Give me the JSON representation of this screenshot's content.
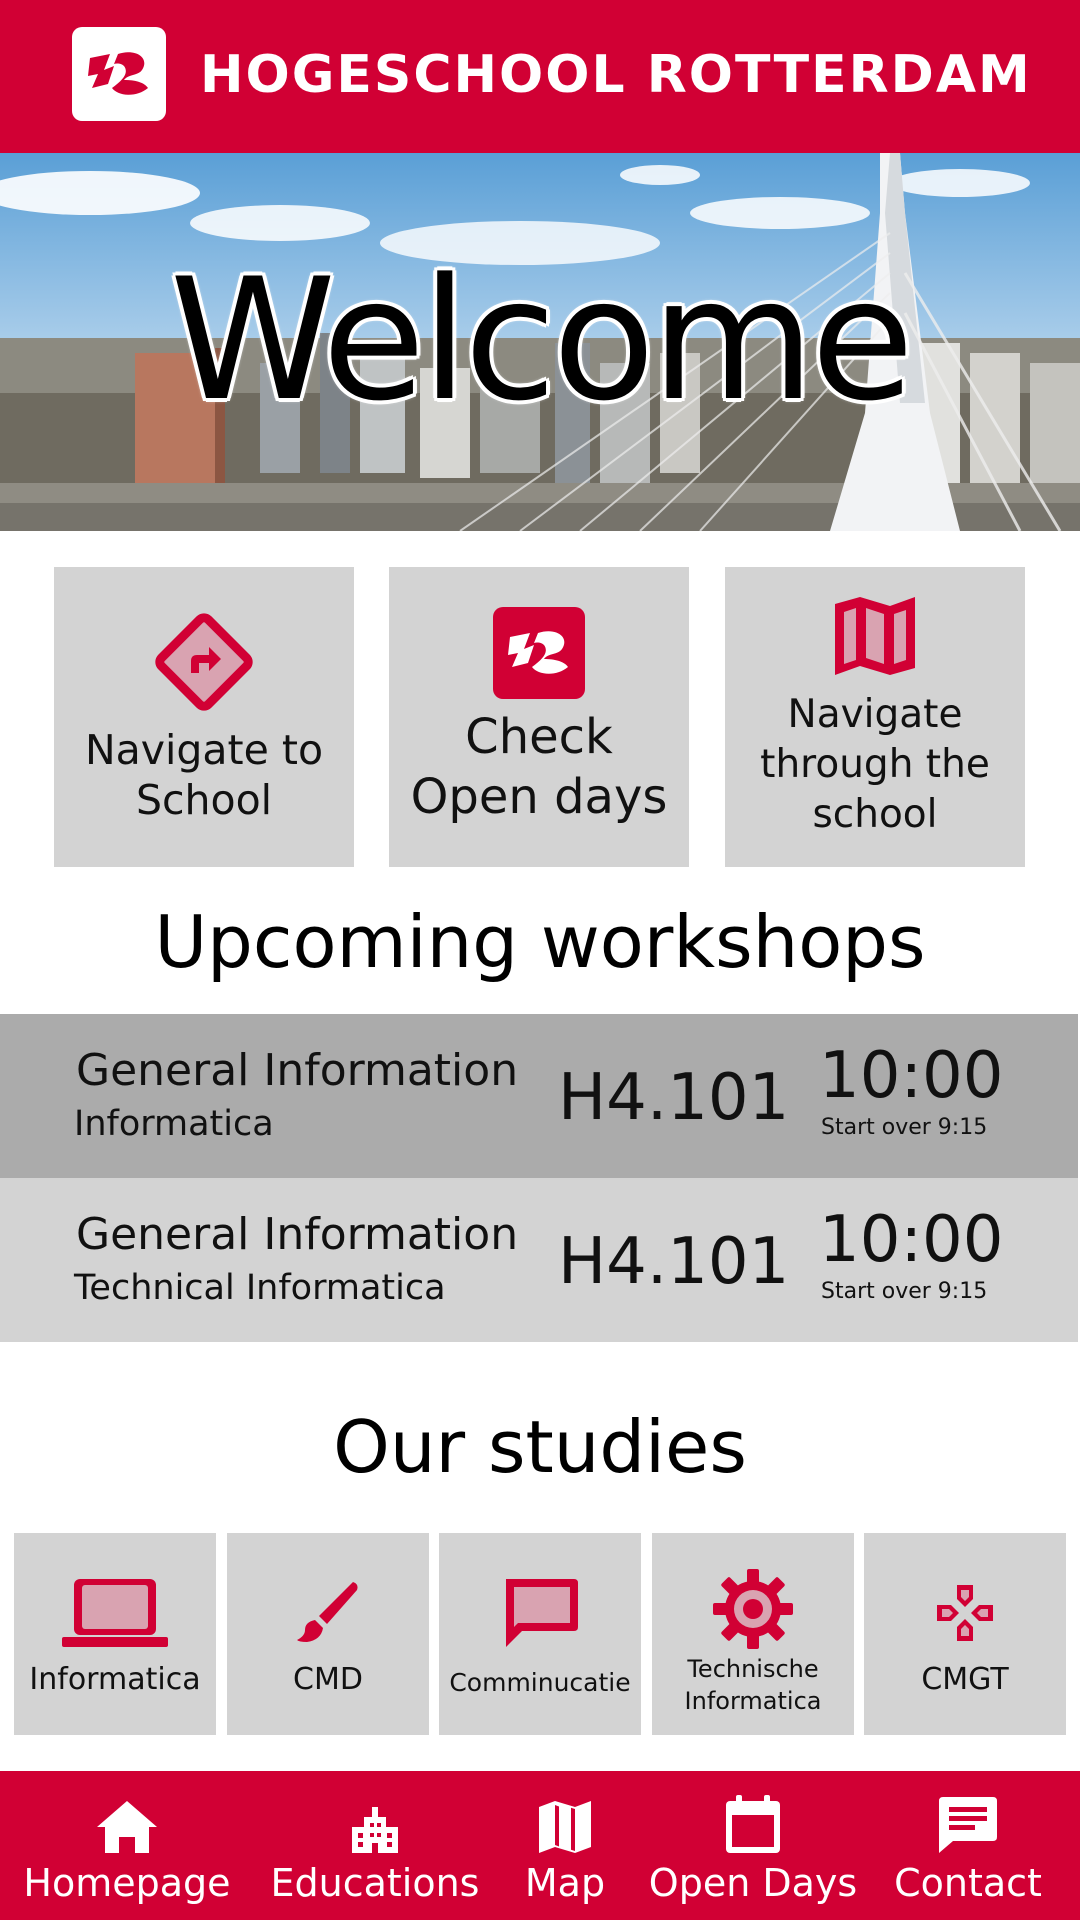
{
  "header": {
    "brand": "HOGESCHOOL ROTTERDAM",
    "logo_icon": "hr-logo-icon"
  },
  "hero": {
    "title": "Welcome"
  },
  "actions": [
    {
      "label_line1": "Navigate to",
      "label_line2": "School",
      "icon": "directions-icon"
    },
    {
      "label_line1": "Check",
      "label_line2": "Open days",
      "icon": "hr-logo-icon"
    },
    {
      "label_line1": "Navigate",
      "label_line2": "through the",
      "label_line3": "school",
      "icon": "map-icon"
    }
  ],
  "workshops": {
    "title": "Upcoming workshops",
    "items": [
      {
        "title": "General Information",
        "study": "Informatica",
        "room": "H4.101",
        "time": "10:00",
        "start": "Start over 9:15"
      },
      {
        "title": "General Information",
        "study": "Technical Informatica",
        "room": "H4.101",
        "time": "10:00",
        "start": "Start over 9:15"
      }
    ]
  },
  "studies": {
    "title": "Our studies",
    "items": [
      {
        "label": "Informatica",
        "icon": "laptop-icon"
      },
      {
        "label": "CMD",
        "icon": "brush-icon"
      },
      {
        "label": "Comminucatie",
        "icon": "message-icon"
      },
      {
        "label_line1": "Technische",
        "label_line2": "Informatica",
        "icon": "gear-icon"
      },
      {
        "label": "CMGT",
        "icon": "gamepad-icon"
      }
    ]
  },
  "nav": {
    "items": [
      {
        "label": "Homepage",
        "icon": "home-icon"
      },
      {
        "label": "Educations",
        "icon": "building-icon"
      },
      {
        "label": "Map",
        "icon": "map-icon"
      },
      {
        "label": "Open Days",
        "icon": "calendar-icon"
      },
      {
        "label": "Contact",
        "icon": "chat-icon"
      }
    ]
  },
  "colors": {
    "brand_red": "#d10034",
    "tile_gray": "#d3d3d3",
    "row_dark": "#ababab",
    "row_light": "#d3d3d3"
  }
}
